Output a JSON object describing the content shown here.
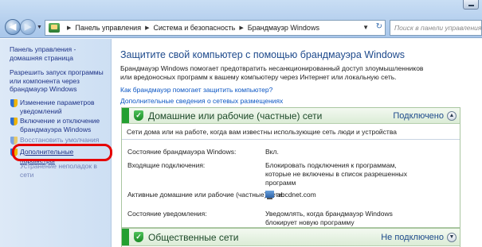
{
  "window": {
    "nav": {
      "back_icon": "back-arrow-icon",
      "forward_icon": "forward-arrow-icon"
    },
    "breadcrumbs": [
      "Панель управления",
      "Система и безопасность",
      "Брандмауэр Windows"
    ],
    "search_placeholder": "Поиск в панели управления"
  },
  "sidebar": {
    "items": [
      {
        "label": "Панель управления - домашняя страница",
        "shield": false
      },
      {
        "label": "Разрешить запуск программы или компонента через брандмауэр Windows",
        "shield": false
      },
      {
        "label": "Изменение параметров уведомлений",
        "shield": true
      },
      {
        "label": "Включение и отключение брандмауэра Windows",
        "shield": true
      },
      {
        "label": "Восстановить умолчания",
        "shield": true
      },
      {
        "label": "Дополнительные параметры",
        "shield": true
      },
      {
        "label": "Устранение неполадок в сети",
        "shield": false
      }
    ]
  },
  "main": {
    "heading": "Защитите свой компьютер с помощью брандмауэра Windows",
    "description": "Брандмауэр Windows помогает предотвратить несанкционированный доступ злоумышленников или вредоносных программ к вашему компьютеру через Интернет или локальную сеть.",
    "link_how": "Как брандмауэр помогает защитить компьютер?",
    "link_locations": "Дополнительные сведения о сетевых размещениях",
    "home_panel": {
      "title": "Домашние или рабочие (частные) сети",
      "status": "Подключено",
      "note": "Сети дома или на работе, когда вам известны использующие сеть люди и устройства",
      "rows": [
        {
          "label": "Состояние брандмауэра Windows:",
          "value": "Вкл."
        },
        {
          "label": "Входящие подключения:",
          "value": "Блокировать подключения к программам, которые не включены в список разрешенных программ"
        },
        {
          "label": "Активные домашние или рабочие (частные) сети:",
          "value": "abcdnet.com"
        },
        {
          "label": "Состояние уведомления:",
          "value": "Уведомлять, когда брандмауэр Windows блокирует новую программу"
        }
      ]
    },
    "public_panel": {
      "title": "Общественные сети",
      "status": "Не подключено"
    }
  },
  "colors": {
    "accent": "#1e4a8c",
    "ok_green": "#23a031",
    "highlight": "#e50000",
    "link": "#0b56c4"
  }
}
